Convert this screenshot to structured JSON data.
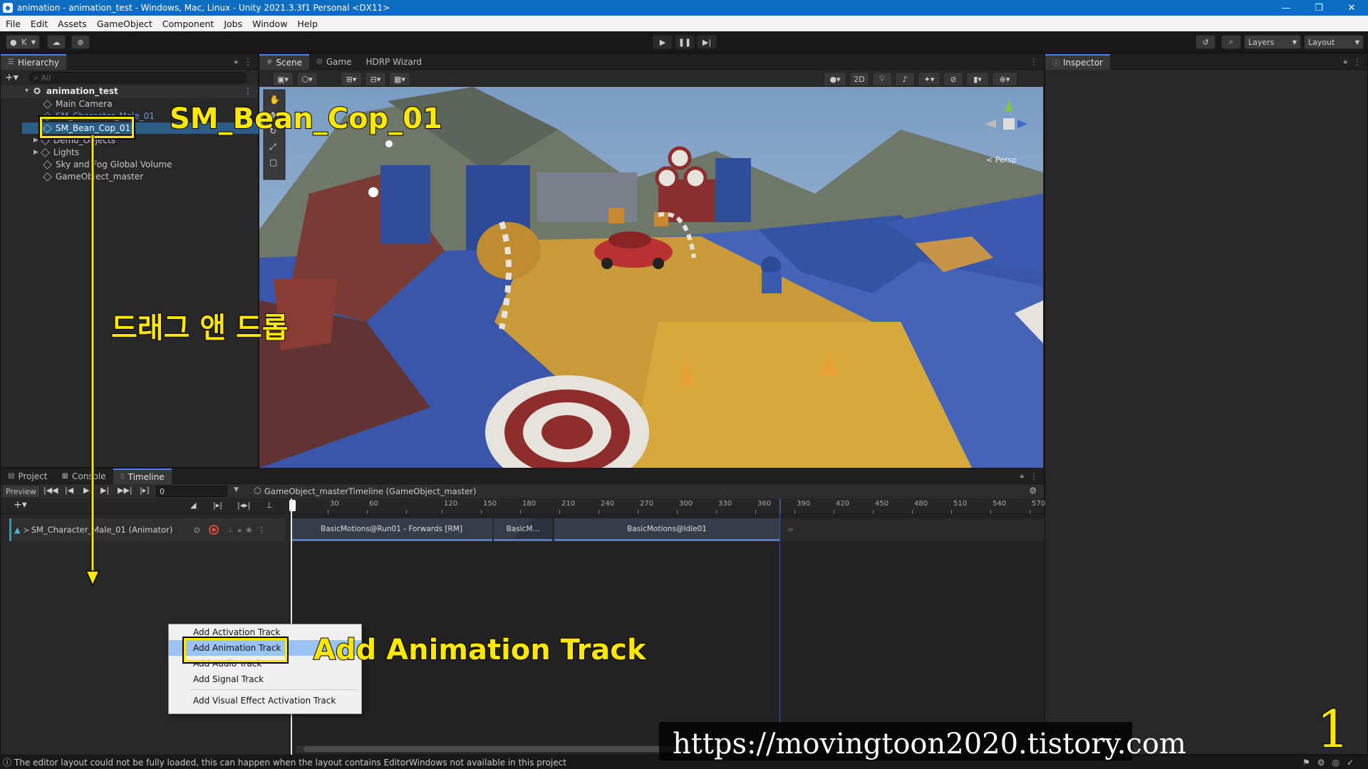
{
  "window": {
    "title": "animation - animation_test - Windows, Mac, Linux - Unity 2021.3.3f1 Personal <DX11>",
    "minimize": "—",
    "maximize": "❐",
    "close": "✕"
  },
  "menu": [
    "File",
    "Edit",
    "Assets",
    "GameObject",
    "Component",
    "Jobs",
    "Window",
    "Help"
  ],
  "toolbar": {
    "account": "K",
    "layers": "Layers",
    "layout": "Layout"
  },
  "hierarchy": {
    "tab": "Hierarchy",
    "search_placeholder": "All",
    "root": "animation_test",
    "items": [
      "Main Camera",
      "SM_Character_Male_01",
      "SM_Bean_Cop_01",
      "Demo_Objects",
      "Lights",
      "Sky and Fog Global Volume",
      "GameObject_master"
    ]
  },
  "scene": {
    "tabs": [
      "Scene",
      "Game",
      "HDRP Wizard"
    ],
    "mode_2d": "2D",
    "persp": "< Persp"
  },
  "inspector": {
    "tab": "Inspector"
  },
  "bottom": {
    "tabs": [
      "Project",
      "Console",
      "Timeline"
    ],
    "preview": "Preview",
    "frame": "0",
    "breadcrumb": "GameObject_masterTimeline (GameObject_master)",
    "ruler": [
      "30",
      "60",
      "120",
      "150",
      "180",
      "210",
      "240",
      "270",
      "300",
      "330",
      "360",
      "390",
      "420",
      "450",
      "480",
      "510",
      "540",
      "570"
    ],
    "track_name": "SM_Character_Male_01 (Animator)",
    "clips": [
      "BasicMotions@Run01 - Forwards [RM]",
      "BasicM...",
      "BasicMotions@Idle01"
    ],
    "infinity": "∞"
  },
  "context_menu": {
    "items": [
      "Add Activation Track",
      "Add Animation Track",
      "Add Audio Track",
      "Add Signal Track",
      "Add Visual Effect Activation Track"
    ]
  },
  "annotations": {
    "bean_cop": "SM_Bean_Cop_01",
    "drag_drop": "드래그 앤 드롭",
    "add_anim": "Add Animation Track",
    "url": "https://movingtoon2020.tistory.com",
    "step": "1"
  },
  "statusbar": {
    "message": "The editor layout could not be fully loaded, this can happen when the layout contains EditorWindows not available in this project"
  },
  "colors": {
    "title_bar": "#0a6dc2",
    "annotation": "#ffe800",
    "selection": "#2c5d87",
    "clip_accent": "#4c7cc2"
  }
}
